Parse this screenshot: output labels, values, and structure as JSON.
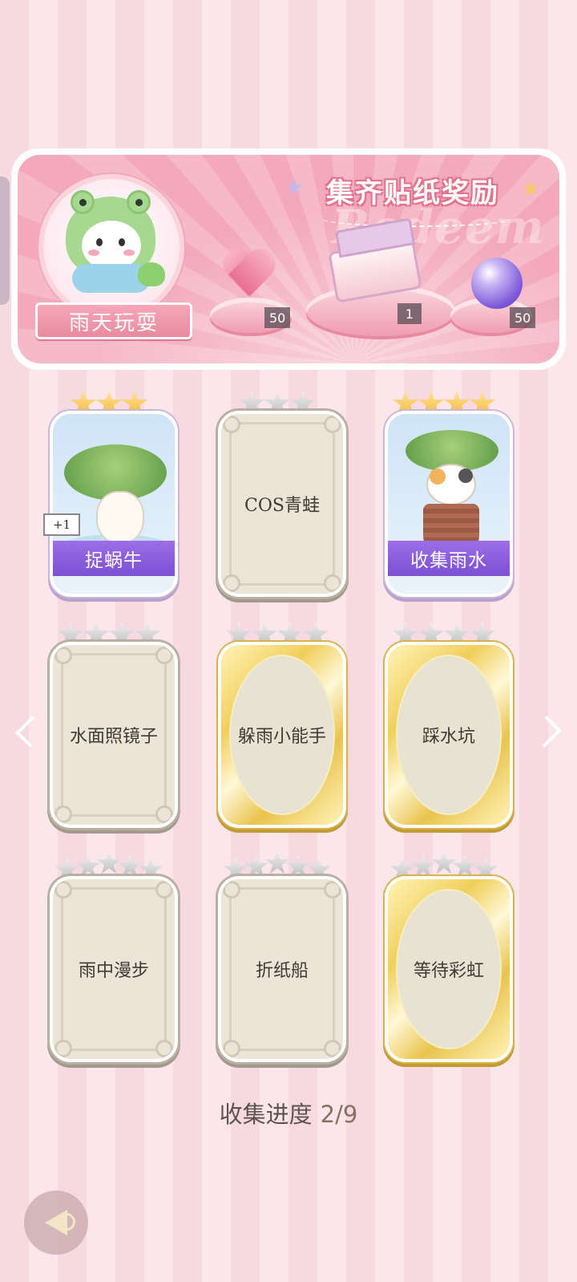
{
  "banner": {
    "title": "集齐贴纸奖励",
    "watermark": "Redeem",
    "theme_name": "雨天玩耍",
    "rewards": [
      {
        "icon": "pink-heart-gem-icon",
        "count": "50"
      },
      {
        "icon": "gift-box-icon",
        "count": "1"
      },
      {
        "icon": "purple-energy-orb-icon",
        "count": "50"
      }
    ]
  },
  "cards": [
    {
      "name": "捉蜗牛",
      "stars_total": 3,
      "stars_earned": 3,
      "state": "collected",
      "badge": "+1"
    },
    {
      "name": "COS青蛙",
      "stars_total": 3,
      "stars_earned": 0,
      "state": "locked"
    },
    {
      "name": "收集雨水",
      "stars_total": 4,
      "stars_earned": 4,
      "state": "collected"
    },
    {
      "name": "水面照镜子",
      "stars_total": 4,
      "stars_earned": 0,
      "state": "locked"
    },
    {
      "name": "躲雨小能手",
      "stars_total": 4,
      "stars_earned": 0,
      "state": "golden"
    },
    {
      "name": "踩水坑",
      "stars_total": 4,
      "stars_earned": 0,
      "state": "golden"
    },
    {
      "name": "雨中漫步",
      "stars_total": 5,
      "stars_earned": 0,
      "state": "locked"
    },
    {
      "name": "折纸船",
      "stars_total": 5,
      "stars_earned": 0,
      "state": "locked"
    },
    {
      "name": "等待彩虹",
      "stars_total": 5,
      "stars_earned": 0,
      "state": "golden"
    }
  ],
  "progress": {
    "label": "收集进度",
    "value": "2/9"
  },
  "colors": {
    "accent_purple": "#8a5cdc",
    "banner_pink": "#f3a9bb",
    "gold": "#f3b73a"
  }
}
